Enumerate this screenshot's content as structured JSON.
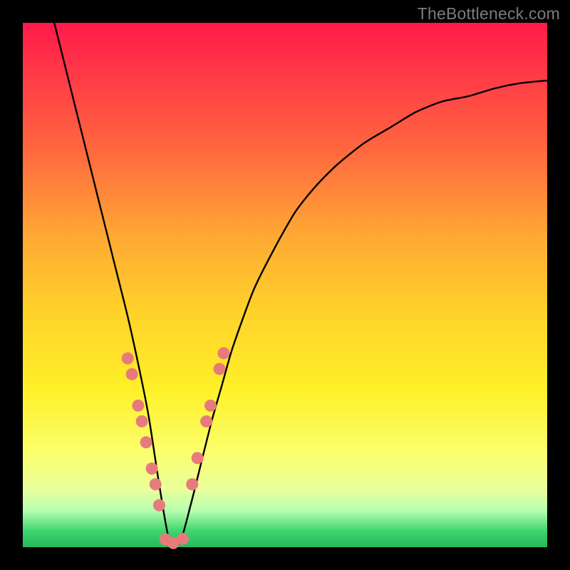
{
  "watermark": "TheBottleneck.com",
  "colors": {
    "dot": "#e77b7c",
    "curve": "#000000",
    "frame": "#000000"
  },
  "chart_data": {
    "type": "line",
    "title": "",
    "xlabel": "",
    "ylabel": "",
    "xlim": [
      0,
      100
    ],
    "ylim": [
      0,
      100
    ],
    "grid": false,
    "legend": false,
    "notes": "V-shaped bottleneck curve on red→green vertical gradient field; trough near x≈28. Axes unlabeled. Pink dots cluster around the trough and on both inner walls (~y 0–35).",
    "series": [
      {
        "name": "bottleneck-curve",
        "x": [
          6,
          8,
          10,
          12,
          14,
          16,
          18,
          20,
          22,
          24,
          26,
          28,
          30,
          32,
          34,
          36,
          38,
          40,
          44,
          48,
          52,
          56,
          60,
          65,
          70,
          75,
          80,
          85,
          90,
          95,
          100
        ],
        "y": [
          100,
          92,
          84,
          76,
          68,
          60,
          52,
          44,
          35,
          25,
          12,
          1,
          1,
          8,
          16,
          24,
          31,
          38,
          49,
          57,
          64,
          69,
          73,
          77,
          80,
          83,
          85,
          86,
          87.5,
          88.5,
          89
        ]
      }
    ],
    "points": [
      {
        "name": "left-wall-dots",
        "coords": [
          {
            "x": 20.0,
            "y": 36
          },
          {
            "x": 20.8,
            "y": 33
          },
          {
            "x": 22.0,
            "y": 27
          },
          {
            "x": 22.7,
            "y": 24
          },
          {
            "x": 23.5,
            "y": 20
          },
          {
            "x": 24.6,
            "y": 15
          },
          {
            "x": 25.3,
            "y": 12
          },
          {
            "x": 26.0,
            "y": 8
          }
        ]
      },
      {
        "name": "right-wall-dots",
        "coords": [
          {
            "x": 32.3,
            "y": 12
          },
          {
            "x": 33.3,
            "y": 17
          },
          {
            "x": 35.0,
            "y": 24
          },
          {
            "x": 35.8,
            "y": 27
          },
          {
            "x": 37.5,
            "y": 34
          },
          {
            "x": 38.3,
            "y": 37
          }
        ]
      },
      {
        "name": "trough-dots",
        "coords": [
          {
            "x": 27.2,
            "y": 1.5
          },
          {
            "x": 28.7,
            "y": 0.8
          },
          {
            "x": 30.5,
            "y": 1.6
          }
        ]
      }
    ]
  }
}
